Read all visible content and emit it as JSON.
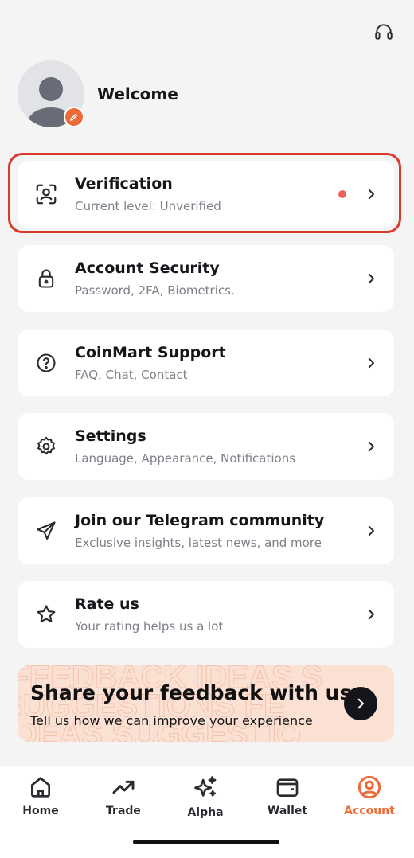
{
  "header": {
    "support_icon": "headset-icon"
  },
  "profile": {
    "welcome": "Welcome",
    "avatar_icon": "user-avatar",
    "edit_icon": "pencil-icon"
  },
  "menu": [
    {
      "title": "Verification",
      "subtitle": "Current level: Unverified",
      "icon": "face-scan-icon",
      "alert": true
    },
    {
      "title": "Account Security",
      "subtitle": "Password, 2FA, Biometrics.",
      "icon": "lock-icon"
    },
    {
      "title": "CoinMart Support",
      "subtitle": "FAQ, Chat, Contact",
      "icon": "help-circle-icon"
    },
    {
      "title": "Settings",
      "subtitle": "Language, Appearance, Notifications",
      "icon": "gear-icon"
    },
    {
      "title": "Join our Telegram community",
      "subtitle": "Exclusive insights, latest news, and more",
      "icon": "send-icon"
    },
    {
      "title": "Rate us",
      "subtitle": "Your rating helps us a lot",
      "icon": "star-icon"
    }
  ],
  "feedback": {
    "title": "Share your feedback with us",
    "subtitle": "Tell us how we can improve your experience",
    "background_text": [
      "FEEDBACK IDEAS S",
      "SUGGESTIONS FE",
      "IDEAS SUGGESTIO"
    ]
  },
  "nav": [
    {
      "label": "Home",
      "icon": "home-icon"
    },
    {
      "label": "Trade",
      "icon": "trend-up-icon"
    },
    {
      "label": "Alpha",
      "icon": "sparkle-icon"
    },
    {
      "label": "Wallet",
      "icon": "wallet-icon"
    },
    {
      "label": "Account",
      "icon": "account-icon",
      "active": true
    }
  ],
  "colors": {
    "accent": "#ee6a37",
    "highlight": "#d93a2e",
    "alert_dot": "#e8645a",
    "background": "#f4f4f5"
  }
}
